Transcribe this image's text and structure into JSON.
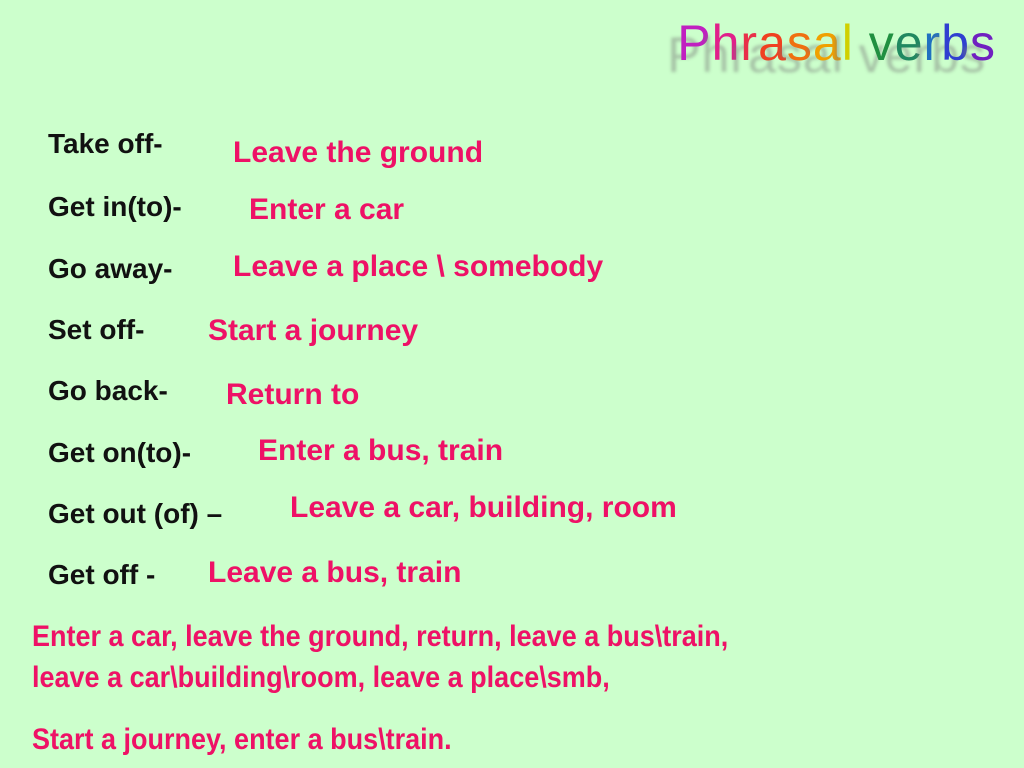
{
  "title": {
    "letters": [
      {
        "ch": "P",
        "color": "#c020c0"
      },
      {
        "ch": "h",
        "color": "#e0208a"
      },
      {
        "ch": "r",
        "color": "#e8304a"
      },
      {
        "ch": "a",
        "color": "#f04020"
      },
      {
        "ch": "s",
        "color": "#f07010"
      },
      {
        "ch": "a",
        "color": "#f0a000"
      },
      {
        "ch": "l",
        "color": "#d0d000"
      },
      {
        "ch": " ",
        "color": "#000000"
      },
      {
        "ch": "v",
        "color": "#209040"
      },
      {
        "ch": "e",
        "color": "#208860"
      },
      {
        "ch": "r",
        "color": "#2070c0"
      },
      {
        "ch": "b",
        "color": "#3040d0"
      },
      {
        "ch": "s",
        "color": "#7020c0"
      }
    ]
  },
  "pairs": [
    {
      "term": "Take off-",
      "definition": "Leave the ground"
    },
    {
      "term": "Get in(to)-",
      "definition": "Enter a car"
    },
    {
      "term": "Go away-",
      "definition": "Leave a place \\ somebody"
    },
    {
      "term": "Set off-",
      "definition": "Start a journey"
    },
    {
      "term": "Go back-",
      "definition": "Return to"
    },
    {
      "term": "Get on(to)-",
      "definition": "Enter a bus, train"
    },
    {
      "term": "Get out (of) –",
      "definition": "Leave a car, building, room"
    },
    {
      "term": "Get off -",
      "definition": "Leave a bus, train"
    }
  ],
  "summary": {
    "line1": "Enter a car,  leave the ground,  return,  leave a bus\\train,",
    "line2": "leave a car\\building\\room,  leave a place\\smb,",
    "line3": "Start a journey,  enter a bus\\train."
  }
}
